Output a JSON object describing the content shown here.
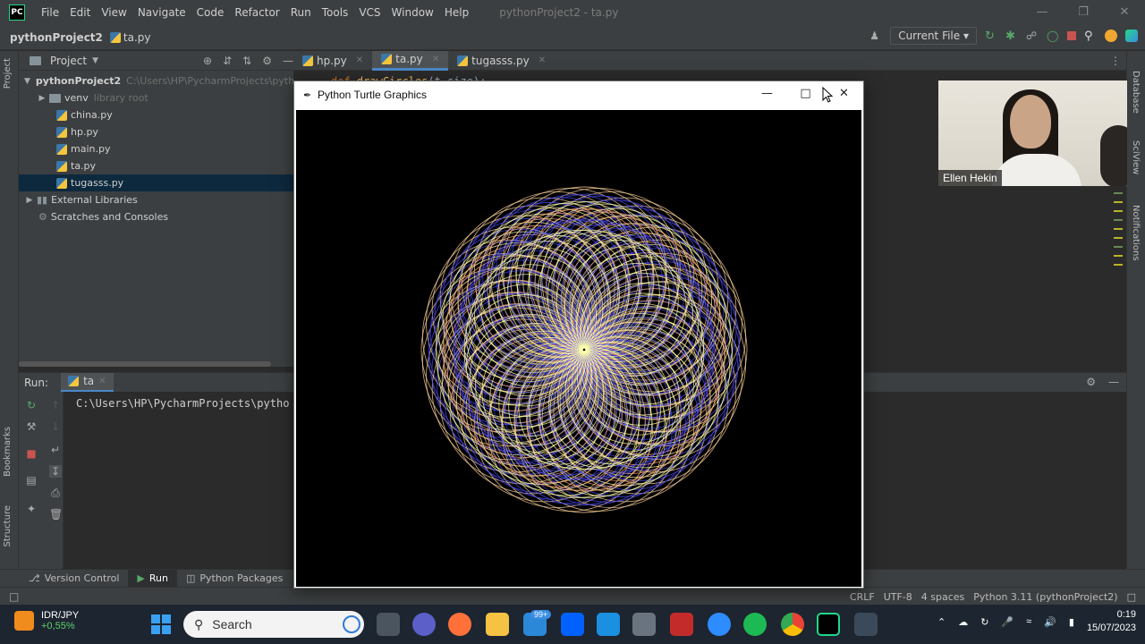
{
  "ide": {
    "app_logo": "PC",
    "menu": [
      "File",
      "Edit",
      "View",
      "Navigate",
      "Code",
      "Refactor",
      "Run",
      "Tools",
      "VCS",
      "Window",
      "Help"
    ],
    "window_title": "pythonProject2 - ta.py",
    "breadcrumb": {
      "project": "pythonProject2",
      "file": "ta.py"
    },
    "run_config": "Current File",
    "project_panel": {
      "title": "Project",
      "tree": [
        {
          "label": "pythonProject2",
          "extra": "C:\\Users\\HP\\PycharmProjects\\pythonP"
        },
        {
          "label": "venv",
          "extra": "library root"
        },
        {
          "label": "china.py"
        },
        {
          "label": "hp.py"
        },
        {
          "label": "main.py"
        },
        {
          "label": "ta.py"
        },
        {
          "label": "tugasss.py"
        },
        {
          "label": "External Libraries"
        },
        {
          "label": "Scratches and Consoles"
        }
      ]
    },
    "editor_tabs": [
      "hp.py",
      "ta.py",
      "tugasss.py"
    ],
    "editor_code_fragment": {
      "keyword": "def",
      "fn": "drawCircles",
      "args": "(t,size):"
    },
    "run_panel": {
      "label": "Run:",
      "tab": "ta",
      "console_line": "C:\\Users\\HP\\PycharmProjects\\pytho"
    },
    "side_tabs": {
      "left": [
        "Project",
        "Bookmarks",
        "Structure"
      ],
      "right": [
        "Database",
        "SciView",
        "Notifications"
      ]
    },
    "tool_tabs": [
      "Version Control",
      "Run",
      "Python Packages"
    ],
    "status": [
      "CRLF",
      "UTF-8",
      "4 spaces",
      "Python 3.11 (pythonProject2)"
    ]
  },
  "turtle_window": {
    "title": "Python Turtle Graphics",
    "controls": [
      "minimize-icon",
      "maximize-icon",
      "close-icon"
    ],
    "pattern_colors": [
      "#ffd39b",
      "#ffffaa",
      "#4a4af0",
      "#ffb07a"
    ]
  },
  "webcam": {
    "name": "Ellen Hekin"
  },
  "taskbar": {
    "ticker": {
      "symbol": "IDR/JPY",
      "change": "+0,55%"
    },
    "search_placeholder": "Search",
    "mail_badge": "99+",
    "clock": {
      "time": "0:19",
      "date": "15/07/2023"
    }
  }
}
